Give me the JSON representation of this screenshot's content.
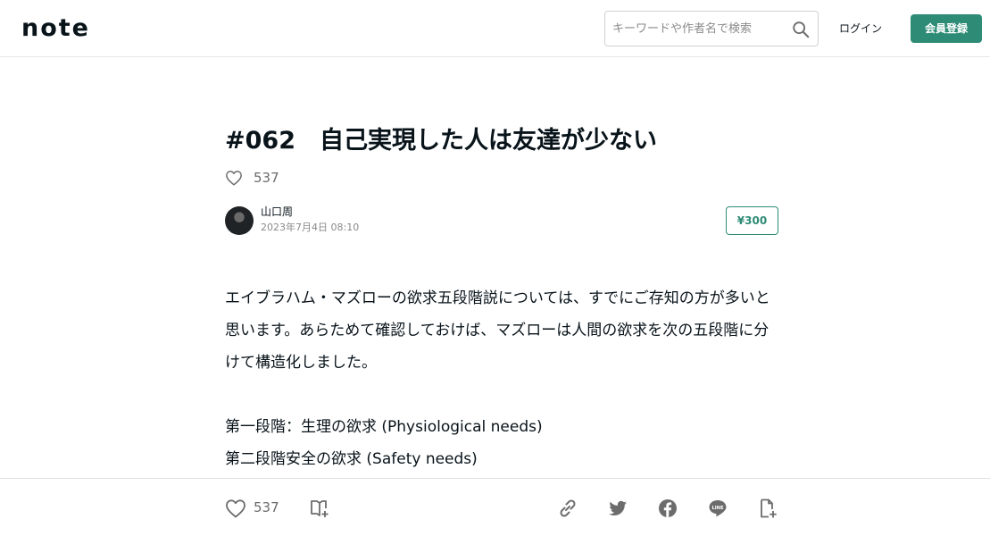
{
  "header": {
    "logo_text": "note",
    "search": {
      "placeholder": "キーワードや作者名で検索"
    },
    "login_label": "ログイン",
    "signup_label": "会員登録"
  },
  "article": {
    "title": "#062　自己実現した人は友達が少ない",
    "like_count": "537",
    "author_name": "山口周",
    "published": "2023年7月4日 08:10",
    "price": "¥300",
    "paragraphs": [
      "エイブラハム・マズローの欲求五段階説については、すでにご存知の方が多いと思います。あらためて確認しておけば、マズローは人間の欲求を次の五段階に分けて構造化しました。",
      "第一段階：生理の欲求 (Physiological needs)",
      "第二段階安全の欲求 (Safety needs)"
    ]
  },
  "footer": {
    "like_count": "537"
  },
  "colors": {
    "brand_green": "#2e8c76",
    "text": "#08131a",
    "muted": "#6c6c6c"
  },
  "icons": [
    "search-icon",
    "heart-icon",
    "magazine-add-icon",
    "link-icon",
    "twitter-icon",
    "facebook-icon",
    "line-icon",
    "embed-icon"
  ]
}
